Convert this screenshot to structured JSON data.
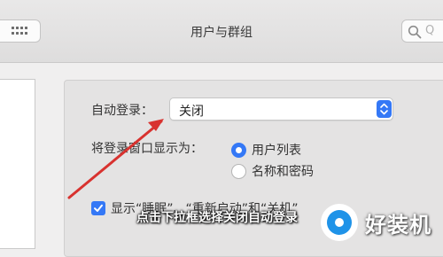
{
  "window": {
    "title": "用户与群组"
  },
  "toolbar": {
    "grid_icon": "grid-icon",
    "search_placeholder": "Q"
  },
  "login_options": {
    "auto_login_label": "自动登录：",
    "auto_login_value": "关闭",
    "display_label": "将登录窗口显示为：",
    "radio_options": [
      {
        "label": "用户列表",
        "selected": true
      },
      {
        "label": "名称和密码",
        "selected": false
      }
    ],
    "checkbox_label": "显示“睡眠”、“重新启动”和“关机”",
    "checkbox_checked": true
  },
  "overlay": {
    "caption": "点击下拉框选择关闭自动登录",
    "watermark": "好装机"
  },
  "colors": {
    "accent": "#3478f6",
    "annotation_arrow": "#d8322f",
    "watermark_blue": "#1f93e8"
  }
}
